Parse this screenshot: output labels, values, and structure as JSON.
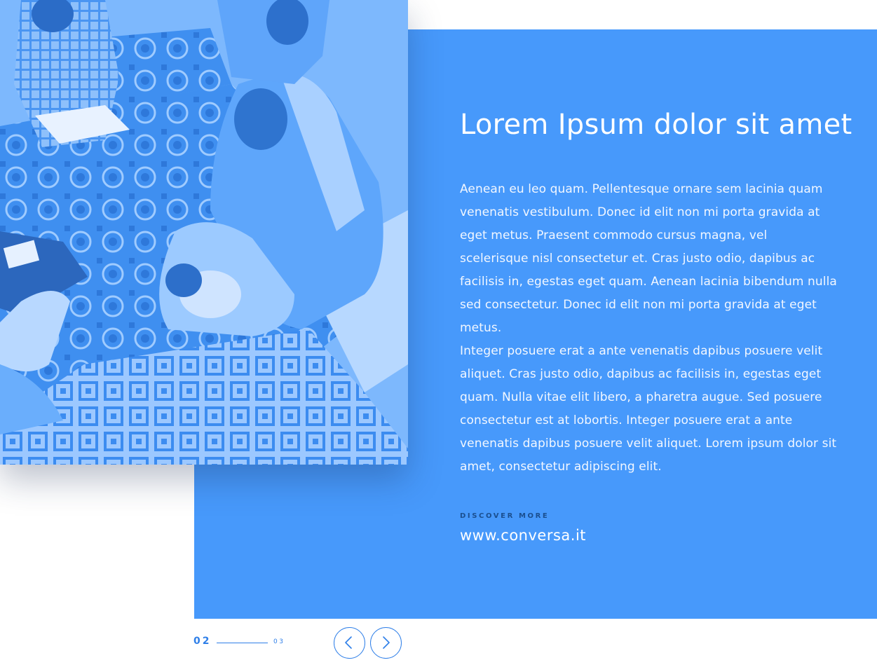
{
  "content": {
    "title": "Lorem Ipsum dolor sit amet",
    "paragraphs": [
      "Aenean eu leo quam. Pellentesque ornare sem lacinia quam venenatis vestibulum. Donec id elit non mi porta gravida at eget metus. Praesent commodo cursus magna, vel scelerisque nisl consectetur et. Cras justo odio, dapibus ac facilisis in, egestas eget quam. Aenean lacinia bibendum nulla sed consectetur. Donec id elit non mi porta gravida at eget metus.",
      "Integer posuere erat a ante venenatis dapibus posuere velit aliquet. Cras justo odio, dapibus ac facilisis in, egestas eget quam. Nulla vitae elit libero, a pharetra augue. Sed posuere consectetur est at lobortis. Integer posuere erat a ante venenatis dapibus posuere velit aliquet. Lorem ipsum dolor sit amet, consectetur adipiscing elit."
    ],
    "discover_label": "DISCOVER MORE",
    "link_text": "www.conversa.it"
  },
  "pager": {
    "current": "02",
    "next": "03",
    "prev_icon": "chevron-left-icon",
    "next_icon": "chevron-right-icon"
  },
  "colors": {
    "panel": "#4799fb",
    "accent": "#2f7fe8",
    "photo_tint": "#5aa6fb",
    "background": "#ffffff"
  }
}
